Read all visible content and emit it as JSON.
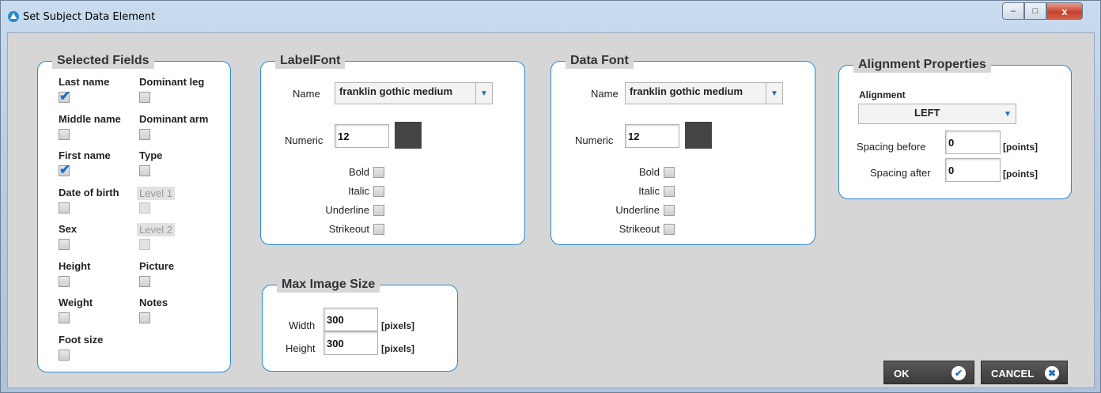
{
  "window": {
    "title": "Set Subject Data Element",
    "controls": {
      "minimize": "–",
      "maximize": "□",
      "close": "x"
    }
  },
  "selected_fields": {
    "legend": "Selected Fields",
    "fields": [
      {
        "label": "Last name",
        "checked": true
      },
      {
        "label": "Dominant leg",
        "checked": false
      },
      {
        "label": "Middle name",
        "checked": false
      },
      {
        "label": "Dominant arm",
        "checked": false
      },
      {
        "label": "First name",
        "checked": true
      },
      {
        "label": "Type",
        "checked": false
      },
      {
        "label": "Date of birth",
        "checked": false
      },
      {
        "label": "Level 1",
        "checked": false,
        "disabled": true
      },
      {
        "label": "Sex",
        "checked": false
      },
      {
        "label": "Level 2",
        "checked": false,
        "disabled": true
      },
      {
        "label": "Height",
        "checked": false
      },
      {
        "label": "Picture",
        "checked": false
      },
      {
        "label": "Weight",
        "checked": false
      },
      {
        "label": "Notes",
        "checked": false
      },
      {
        "label": "Foot size",
        "checked": false
      }
    ]
  },
  "label_font": {
    "legend": "LabelFont",
    "name_label": "Name",
    "name_value": "franklin gothic medium",
    "numeric_label": "Numeric",
    "numeric_value": "12",
    "color": "#444444",
    "styles": [
      "Bold",
      "Italic",
      "Underline",
      "Strikeout"
    ]
  },
  "data_font": {
    "legend": "Data Font",
    "name_label": "Name",
    "name_value": "franklin gothic medium",
    "numeric_label": "Numeric",
    "numeric_value": "12",
    "color": "#444444",
    "styles": [
      "Bold",
      "Italic",
      "Underline",
      "Strikeout"
    ]
  },
  "alignment": {
    "legend": "Alignment Properties",
    "alignment_label": "Alignment",
    "alignment_value": "LEFT",
    "spacing_before_label": "Spacing before",
    "spacing_before_value": "0",
    "spacing_after_label": "Spacing after",
    "spacing_after_value": "0",
    "unit": "[points]"
  },
  "max_image": {
    "legend": "Max Image Size",
    "width_label": "Width",
    "width_value": "300",
    "height_label": "Height",
    "height_value": "300",
    "unit": "[pixels]"
  },
  "buttons": {
    "ok": "OK",
    "cancel": "CANCEL"
  },
  "colors": {
    "accent": "#2a8ad2",
    "check": "#1f6fc2",
    "button": "#444444"
  }
}
